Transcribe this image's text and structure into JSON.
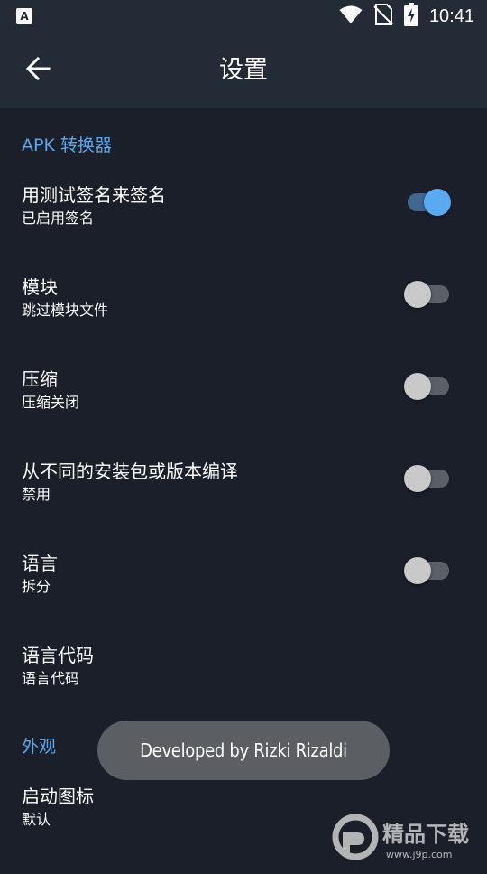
{
  "status_bar": {
    "app_icon_letter": "A",
    "time": "10:41",
    "icons": [
      "wifi-icon",
      "no-signal-icon",
      "battery-charging-icon"
    ]
  },
  "app_bar": {
    "title": "设置",
    "back_icon": "arrow-left-icon"
  },
  "sections": [
    {
      "header": "APK 转换器",
      "items": [
        {
          "title": "用测试签名来签名",
          "summary": "已启用签名",
          "switch": true
        },
        {
          "title": "模块",
          "summary": "跳过模块文件",
          "switch": false
        },
        {
          "title": "压缩",
          "summary": "压缩关闭",
          "switch": false
        },
        {
          "title": "从不同的安装包或版本编译",
          "summary": "禁用",
          "switch": false
        },
        {
          "title": "语言",
          "summary": "拆分",
          "switch": false
        },
        {
          "title": "语言代码",
          "summary": "语言代码"
        }
      ]
    },
    {
      "header": "外观",
      "items": [
        {
          "title": "启动图标",
          "summary": "默认"
        }
      ]
    }
  ],
  "toast": {
    "text": "Developed by Rizki Rizaldi"
  },
  "watermark": {
    "brand": "精品下载",
    "url": "www.j9p.com"
  },
  "colors": {
    "background": "#1a1f29",
    "app_bar": "#232b37",
    "accent": "#5aa9f0"
  }
}
